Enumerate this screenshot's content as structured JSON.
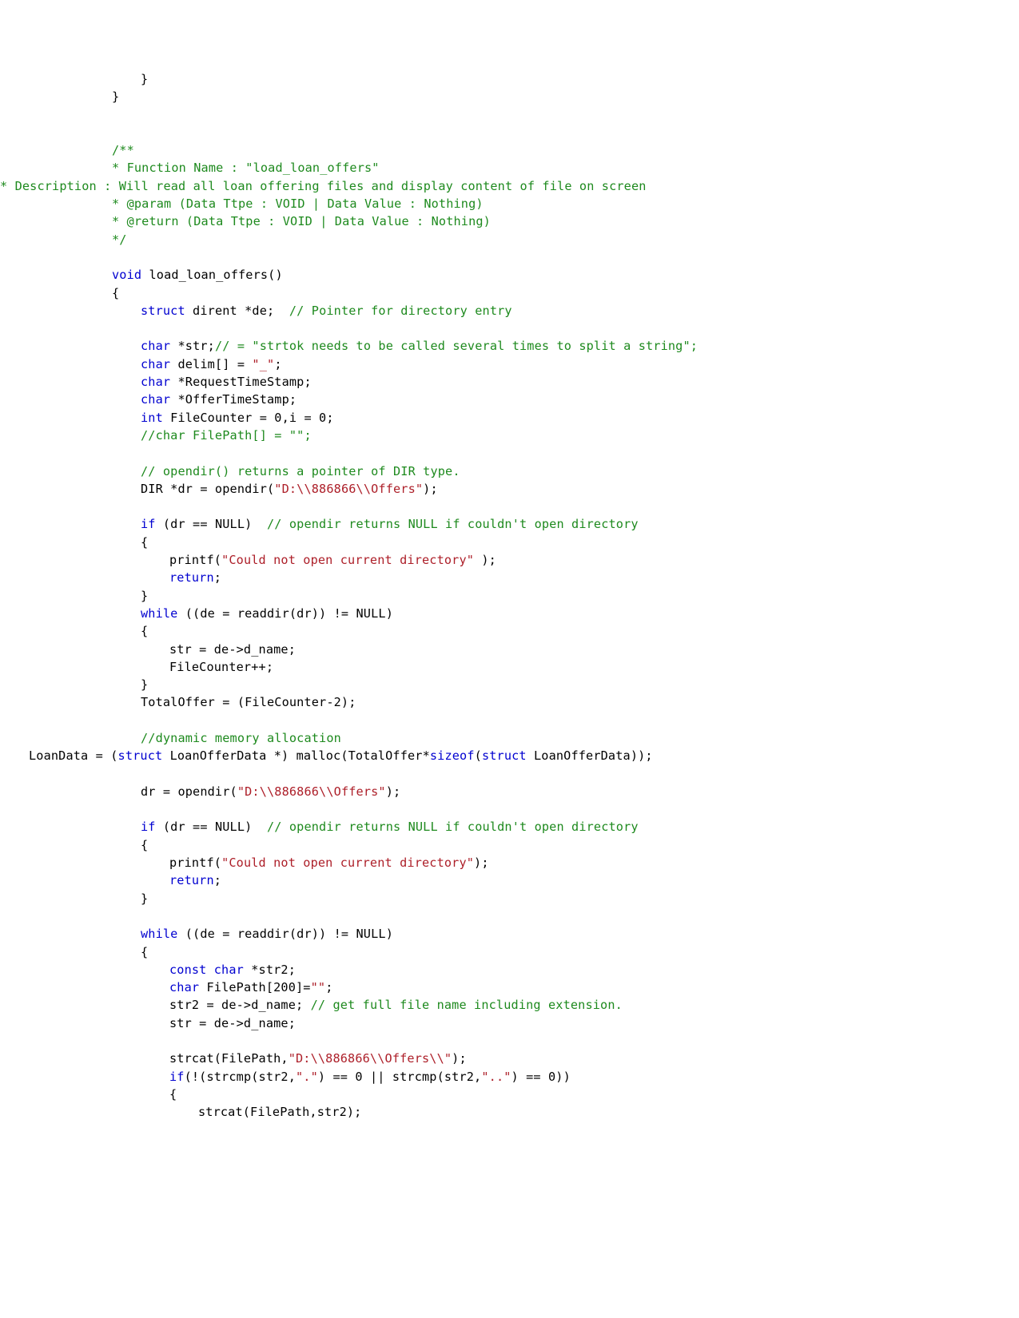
{
  "document": {
    "kind": "source-code-listing",
    "language": "C",
    "background_color": "#FFFFFF",
    "colors": {
      "plain": "#000000",
      "keyword": "#0000D0",
      "comment": "#1E8A1E",
      "string": "#AD1F29"
    }
  },
  "code": {
    "lines": [
      {
        "id": "l1",
        "indent": 2,
        "tokens": [
          {
            "t": "}",
            "c": "pl"
          }
        ]
      },
      {
        "id": "l2",
        "indent": 0,
        "tokens": [
          {
            "t": "}",
            "c": "pl"
          }
        ]
      },
      {
        "id": "l3",
        "blank": true
      },
      {
        "id": "l4",
        "blank": true
      },
      {
        "id": "l5",
        "indent": 0,
        "tokens": [
          {
            "t": "/**",
            "c": "cm"
          }
        ]
      },
      {
        "id": "l6",
        "indent": 0,
        "tokens": [
          {
            "t": "* Function Name : \"load_loan_offers\"",
            "c": "cm"
          }
        ]
      },
      {
        "id": "l7",
        "indent": 0,
        "wrap": true,
        "tokens": [
          {
            "t": "* Description : Will read all loan offering files and display content of file on screen",
            "c": "cm"
          }
        ]
      },
      {
        "id": "l8",
        "indent": 0,
        "tokens": [
          {
            "t": "* @param (Data Ttpe : VOID | Data Value : Nothing)",
            "c": "cm"
          }
        ]
      },
      {
        "id": "l9",
        "indent": 0,
        "tokens": [
          {
            "t": "* @return (Data Ttpe : VOID | Data Value : Nothing)",
            "c": "cm"
          }
        ]
      },
      {
        "id": "l10",
        "indent": 0,
        "tokens": [
          {
            "t": "*/",
            "c": "cm"
          }
        ]
      },
      {
        "id": "l11",
        "blank": true
      },
      {
        "id": "l12",
        "indent": 0,
        "tokens": [
          {
            "t": "void",
            "c": "kw"
          },
          {
            "t": " load_loan_offers()",
            "c": "pl"
          }
        ]
      },
      {
        "id": "l13",
        "indent": 0,
        "tokens": [
          {
            "t": "{",
            "c": "pl"
          }
        ]
      },
      {
        "id": "l14",
        "indent": 2,
        "tokens": [
          {
            "t": "struct",
            "c": "kw"
          },
          {
            "t": " dirent *de;  ",
            "c": "pl"
          },
          {
            "t": "// Pointer for directory entry",
            "c": "cm"
          }
        ]
      },
      {
        "id": "l15",
        "blank": true
      },
      {
        "id": "l16",
        "indent": 2,
        "tokens": [
          {
            "t": "char",
            "c": "kw"
          },
          {
            "t": " *str;",
            "c": "pl"
          },
          {
            "t": "// = \"strtok needs to be called several times to split a string\";",
            "c": "cm"
          }
        ]
      },
      {
        "id": "l17",
        "indent": 2,
        "tokens": [
          {
            "t": "char",
            "c": "kw"
          },
          {
            "t": " delim[] = ",
            "c": "pl"
          },
          {
            "t": "\"_\"",
            "c": "str"
          },
          {
            "t": ";",
            "c": "pl"
          }
        ]
      },
      {
        "id": "l18",
        "indent": 2,
        "tokens": [
          {
            "t": "char",
            "c": "kw"
          },
          {
            "t": " *RequestTimeStamp;",
            "c": "pl"
          }
        ]
      },
      {
        "id": "l19",
        "indent": 2,
        "tokens": [
          {
            "t": "char",
            "c": "kw"
          },
          {
            "t": " *OfferTimeStamp;",
            "c": "pl"
          }
        ]
      },
      {
        "id": "l20",
        "indent": 2,
        "tokens": [
          {
            "t": "int",
            "c": "kw"
          },
          {
            "t": " FileCounter = 0,i = 0;",
            "c": "pl"
          }
        ]
      },
      {
        "id": "l21",
        "indent": 2,
        "tokens": [
          {
            "t": "//char FilePath[] = \"\";",
            "c": "cm"
          }
        ]
      },
      {
        "id": "l22",
        "blank": true
      },
      {
        "id": "l23",
        "indent": 2,
        "tokens": [
          {
            "t": "// opendir() returns a pointer of DIR type.",
            "c": "cm"
          }
        ]
      },
      {
        "id": "l24",
        "indent": 2,
        "tokens": [
          {
            "t": "DIR *dr = opendir(",
            "c": "pl"
          },
          {
            "t": "\"D:\\\\886866\\\\Offers\"",
            "c": "str"
          },
          {
            "t": ");",
            "c": "pl"
          }
        ]
      },
      {
        "id": "l25",
        "blank": true
      },
      {
        "id": "l26",
        "indent": 2,
        "tokens": [
          {
            "t": "if",
            "c": "kw"
          },
          {
            "t": " (dr == NULL)  ",
            "c": "pl"
          },
          {
            "t": "// opendir returns NULL if couldn't open directory",
            "c": "cm"
          }
        ]
      },
      {
        "id": "l27",
        "indent": 2,
        "tokens": [
          {
            "t": "{",
            "c": "pl"
          }
        ]
      },
      {
        "id": "l28",
        "indent": 4,
        "tokens": [
          {
            "t": "printf(",
            "c": "pl"
          },
          {
            "t": "\"Could not open current directory\"",
            "c": "str"
          },
          {
            "t": " );",
            "c": "pl"
          }
        ]
      },
      {
        "id": "l29",
        "indent": 4,
        "tokens": [
          {
            "t": "return",
            "c": "kw"
          },
          {
            "t": ";",
            "c": "pl"
          }
        ]
      },
      {
        "id": "l30",
        "indent": 2,
        "tokens": [
          {
            "t": "}",
            "c": "pl"
          }
        ]
      },
      {
        "id": "l31",
        "indent": 2,
        "tokens": [
          {
            "t": "while",
            "c": "kw"
          },
          {
            "t": " ((de = readdir(dr)) != NULL)",
            "c": "pl"
          }
        ]
      },
      {
        "id": "l32",
        "indent": 2,
        "tokens": [
          {
            "t": "{",
            "c": "pl"
          }
        ]
      },
      {
        "id": "l33",
        "indent": 4,
        "tokens": [
          {
            "t": "str = de->d_name;",
            "c": "pl"
          }
        ]
      },
      {
        "id": "l34",
        "indent": 4,
        "tokens": [
          {
            "t": "FileCounter++;",
            "c": "pl"
          }
        ]
      },
      {
        "id": "l35",
        "indent": 2,
        "tokens": [
          {
            "t": "}",
            "c": "pl"
          }
        ]
      },
      {
        "id": "l36",
        "indent": 2,
        "tokens": [
          {
            "t": "TotalOffer = (FileCounter-2);",
            "c": "pl"
          }
        ]
      },
      {
        "id": "l37",
        "blank": true
      },
      {
        "id": "l38",
        "indent": 2,
        "tokens": [
          {
            "t": "//dynamic memory allocation",
            "c": "cm"
          }
        ]
      },
      {
        "id": "l39",
        "indent": 2,
        "wrap": true,
        "tokens": [
          {
            "t": "LoanData = (",
            "c": "pl"
          },
          {
            "t": "struct",
            "c": "kw"
          },
          {
            "t": " LoanOfferData *) malloc(TotalOffer*",
            "c": "pl"
          },
          {
            "t": "sizeof",
            "c": "kw"
          },
          {
            "t": "(",
            "c": "pl"
          },
          {
            "t": "struct",
            "c": "kw"
          },
          {
            "t": " LoanOfferData));",
            "c": "pl"
          }
        ]
      },
      {
        "id": "l40",
        "blank": true
      },
      {
        "id": "l41",
        "indent": 2,
        "tokens": [
          {
            "t": "dr = opendir(",
            "c": "pl"
          },
          {
            "t": "\"D:\\\\886866\\\\Offers\"",
            "c": "str"
          },
          {
            "t": ");",
            "c": "pl"
          }
        ]
      },
      {
        "id": "l42",
        "blank": true
      },
      {
        "id": "l43",
        "indent": 2,
        "tokens": [
          {
            "t": "if",
            "c": "kw"
          },
          {
            "t": " (dr == NULL)  ",
            "c": "pl"
          },
          {
            "t": "// opendir returns NULL if couldn't open directory",
            "c": "cm"
          }
        ]
      },
      {
        "id": "l44",
        "indent": 2,
        "tokens": [
          {
            "t": "{",
            "c": "pl"
          }
        ]
      },
      {
        "id": "l45",
        "indent": 4,
        "tokens": [
          {
            "t": "printf(",
            "c": "pl"
          },
          {
            "t": "\"Could not open current directory\"",
            "c": "str"
          },
          {
            "t": ");",
            "c": "pl"
          }
        ]
      },
      {
        "id": "l46",
        "indent": 4,
        "tokens": [
          {
            "t": "return",
            "c": "kw"
          },
          {
            "t": ";",
            "c": "pl"
          }
        ]
      },
      {
        "id": "l47",
        "indent": 2,
        "tokens": [
          {
            "t": "}",
            "c": "pl"
          }
        ]
      },
      {
        "id": "l48",
        "blank": true
      },
      {
        "id": "l49",
        "indent": 2,
        "tokens": [
          {
            "t": "while",
            "c": "kw"
          },
          {
            "t": " ((de = readdir(dr)) != NULL)",
            "c": "pl"
          }
        ]
      },
      {
        "id": "l50",
        "indent": 2,
        "tokens": [
          {
            "t": "{",
            "c": "pl"
          }
        ]
      },
      {
        "id": "l51",
        "indent": 4,
        "tokens": [
          {
            "t": "const",
            "c": "kw"
          },
          {
            "t": " ",
            "c": "pl"
          },
          {
            "t": "char",
            "c": "kw"
          },
          {
            "t": " *str2;",
            "c": "pl"
          }
        ]
      },
      {
        "id": "l52",
        "indent": 4,
        "tokens": [
          {
            "t": "char",
            "c": "kw"
          },
          {
            "t": " FilePath[200]=",
            "c": "pl"
          },
          {
            "t": "\"\"",
            "c": "str"
          },
          {
            "t": ";",
            "c": "pl"
          }
        ]
      },
      {
        "id": "l53",
        "indent": 4,
        "tokens": [
          {
            "t": "str2 = de->d_name; ",
            "c": "pl"
          },
          {
            "t": "// get full file name including extension.",
            "c": "cm"
          }
        ]
      },
      {
        "id": "l54",
        "indent": 4,
        "tokens": [
          {
            "t": "str = de->d_name;",
            "c": "pl"
          }
        ]
      },
      {
        "id": "l55",
        "blank": true
      },
      {
        "id": "l56",
        "indent": 4,
        "tokens": [
          {
            "t": "strcat(FilePath,",
            "c": "pl"
          },
          {
            "t": "\"D:\\\\886866\\\\Offers\\\\\"",
            "c": "str"
          },
          {
            "t": ");",
            "c": "pl"
          }
        ]
      },
      {
        "id": "l57",
        "indent": 4,
        "tokens": [
          {
            "t": "if",
            "c": "kw"
          },
          {
            "t": "(!(strcmp(str2,",
            "c": "pl"
          },
          {
            "t": "\".\"",
            "c": "str"
          },
          {
            "t": ") == 0 || strcmp(str2,",
            "c": "pl"
          },
          {
            "t": "\"..\"",
            "c": "str"
          },
          {
            "t": ") == 0))",
            "c": "pl"
          }
        ]
      },
      {
        "id": "l58",
        "indent": 4,
        "tokens": [
          {
            "t": "{",
            "c": "pl"
          }
        ]
      },
      {
        "id": "l59",
        "indent": 6,
        "tokens": [
          {
            "t": "strcat(FilePath,str2);",
            "c": "pl"
          }
        ]
      }
    ]
  }
}
